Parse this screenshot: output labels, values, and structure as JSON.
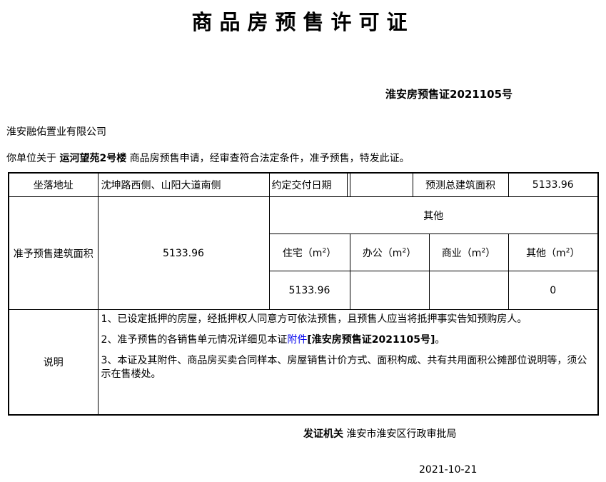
{
  "title": "商品房预售许可证",
  "cert_number": "淮安房预售证2021105号",
  "company": "淮安融佑置业有限公司",
  "intro": {
    "prefix": "你单位关于",
    "project": "运河望苑2号楼",
    "suffix": "商品房预售申请，经审查符合法定条件，准予预售，特发此证。"
  },
  "row1": {
    "location_label": "坐落地址",
    "location_value": "沈坤路西侧、山阳大道南侧",
    "delivery_label": "约定交付日期",
    "delivery_value": "",
    "total_area_label": "预测总建筑面积",
    "total_area_value": "5133.96"
  },
  "area": {
    "label": "准予预售建筑面积",
    "value": "5133.96",
    "other_header": "其他",
    "columns": [
      {
        "name": "住宅（m",
        "unit_sup": "2",
        "close": "）",
        "value": "5133.96"
      },
      {
        "name": "办公（m",
        "unit_sup": "2",
        "close": "）",
        "value": ""
      },
      {
        "name": "商业（m",
        "unit_sup": "2",
        "close": "）",
        "value": ""
      },
      {
        "name": "其他（m",
        "unit_sup": "2",
        "close": "）",
        "value": "0"
      }
    ]
  },
  "notes": {
    "label": "说明",
    "line1": "1、已设定抵押的房屋，经抵押权人同意方可依法预售，且预售人应当将抵押事实告知预购房人。",
    "line2_prefix": "2、准予预售的各销售单元情况详细见本证",
    "line2_link": "附件",
    "line2_bold": "[淮安房预售证2021105号]",
    "line2_suffix": "。",
    "line3": "3、本证及其附件、商品房买卖合同样本、房屋销售计价方式、面积构成、共有共用面积公摊部位说明等，须公示在售楼处。"
  },
  "issuer": {
    "label": "发证机关",
    "value": "淮安市淮安区行政审批局"
  },
  "date": "2021-10-21"
}
